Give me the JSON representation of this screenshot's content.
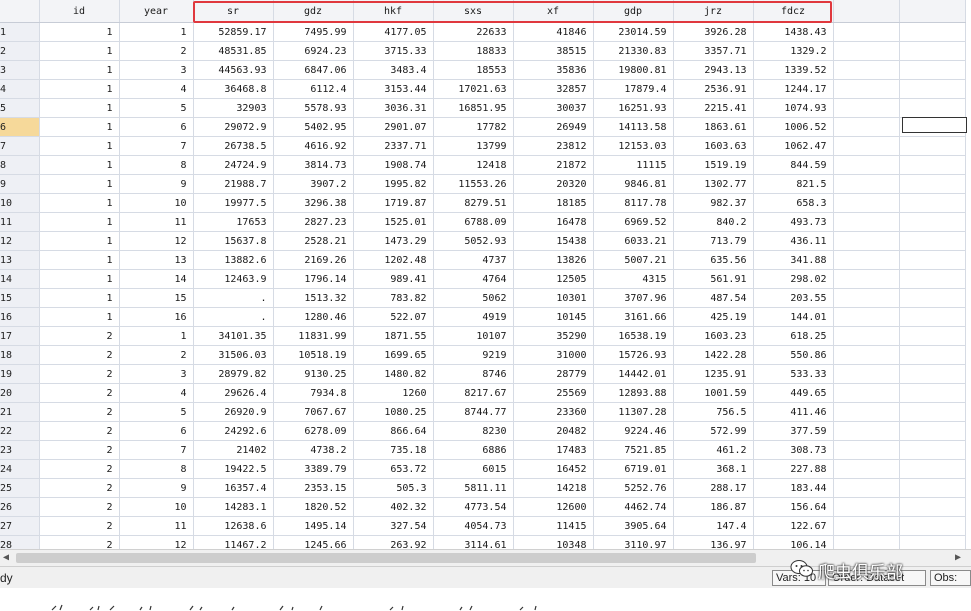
{
  "columns": [
    "id",
    "year",
    "sr",
    "gdz",
    "hkf",
    "sxs",
    "xf",
    "gdp",
    "jrz",
    "fdcz"
  ],
  "active_row": 6,
  "rows": [
    [
      "1",
      "1",
      "1",
      "52859.17",
      "7495.99",
      "4177.05",
      "22633",
      "41846",
      "23014.59",
      "3926.28",
      "1438.43"
    ],
    [
      "2",
      "1",
      "2",
      "48531.85",
      "6924.23",
      "3715.33",
      "18833",
      "38515",
      "21330.83",
      "3357.71",
      "1329.2"
    ],
    [
      "3",
      "1",
      "3",
      "44563.93",
      "6847.06",
      "3483.4",
      "18553",
      "35836",
      "19800.81",
      "2943.13",
      "1339.52"
    ],
    [
      "4",
      "1",
      "4",
      "36468.8",
      "6112.4",
      "3153.44",
      "17021.63",
      "32857",
      "17879.4",
      "2536.91",
      "1244.17"
    ],
    [
      "5",
      "1",
      "5",
      "32903",
      "5578.93",
      "3036.31",
      "16851.95",
      "30037",
      "16251.93",
      "2215.41",
      "1074.93"
    ],
    [
      "6",
      "1",
      "6",
      "29072.9",
      "5402.95",
      "2901.07",
      "17782",
      "26949",
      "14113.58",
      "1863.61",
      "1006.52"
    ],
    [
      "7",
      "1",
      "7",
      "26738.5",
      "4616.92",
      "2337.71",
      "13799",
      "23812",
      "12153.03",
      "1603.63",
      "1062.47"
    ],
    [
      "8",
      "1",
      "8",
      "24724.9",
      "3814.73",
      "1908.74",
      "12418",
      "21872",
      "11115",
      "1519.19",
      "844.59"
    ],
    [
      "9",
      "1",
      "9",
      "21988.7",
      "3907.2",
      "1995.82",
      "11553.26",
      "20320",
      "9846.81",
      "1302.77",
      "821.5"
    ],
    [
      "10",
      "1",
      "10",
      "19977.5",
      "3296.38",
      "1719.87",
      "8279.51",
      "18185",
      "8117.78",
      "982.37",
      "658.3"
    ],
    [
      "11",
      "1",
      "11",
      "17653",
      "2827.23",
      "1525.01",
      "6788.09",
      "16478",
      "6969.52",
      "840.2",
      "493.73"
    ],
    [
      "12",
      "1",
      "12",
      "15637.8",
      "2528.21",
      "1473.29",
      "5052.93",
      "15438",
      "6033.21",
      "713.79",
      "436.11"
    ],
    [
      "13",
      "1",
      "13",
      "13882.6",
      "2169.26",
      "1202.48",
      "4737",
      "13826",
      "5007.21",
      "635.56",
      "341.88"
    ],
    [
      "14",
      "1",
      "14",
      "12463.9",
      "1796.14",
      "989.41",
      "4764",
      "12505",
      "4315",
      "561.91",
      "298.02"
    ],
    [
      "15",
      "1",
      "15",
      ".",
      "1513.32",
      "783.82",
      "5062",
      "10301",
      "3707.96",
      "487.54",
      "203.55"
    ],
    [
      "16",
      "1",
      "16",
      ".",
      "1280.46",
      "522.07",
      "4919",
      "10145",
      "3161.66",
      "425.19",
      "144.01"
    ],
    [
      "17",
      "2",
      "1",
      "34101.35",
      "11831.99",
      "1871.55",
      "10107",
      "35290",
      "16538.19",
      "1603.23",
      "618.25"
    ],
    [
      "18",
      "2",
      "2",
      "31506.03",
      "10518.19",
      "1699.65",
      "9219",
      "31000",
      "15726.93",
      "1422.28",
      "550.86"
    ],
    [
      "19",
      "2",
      "3",
      "28979.82",
      "9130.25",
      "1480.82",
      "8746",
      "28779",
      "14442.01",
      "1235.91",
      "533.33"
    ],
    [
      "20",
      "2",
      "4",
      "29626.4",
      "7934.8",
      "1260",
      "8217.67",
      "25569",
      "12893.88",
      "1001.59",
      "449.65"
    ],
    [
      "21",
      "2",
      "5",
      "26920.9",
      "7067.67",
      "1080.25",
      "8744.77",
      "23360",
      "11307.28",
      "756.5",
      "411.46"
    ],
    [
      "22",
      "2",
      "6",
      "24292.6",
      "6278.09",
      "866.64",
      "8230",
      "20482",
      "9224.46",
      "572.99",
      "377.59"
    ],
    [
      "23",
      "2",
      "7",
      "21402",
      "4738.2",
      "735.18",
      "6886",
      "17483",
      "7521.85",
      "461.2",
      "308.73"
    ],
    [
      "24",
      "2",
      "8",
      "19422.5",
      "3389.79",
      "653.72",
      "6015",
      "16452",
      "6719.01",
      "368.1",
      "227.88"
    ],
    [
      "25",
      "2",
      "9",
      "16357.4",
      "2353.15",
      "505.3",
      "5811.11",
      "14218",
      "5252.76",
      "288.17",
      "183.44"
    ],
    [
      "26",
      "2",
      "10",
      "14283.1",
      "1820.52",
      "402.32",
      "4773.54",
      "12600",
      "4462.74",
      "186.87",
      "156.64"
    ],
    [
      "27",
      "2",
      "11",
      "12638.6",
      "1495.14",
      "327.54",
      "4054.73",
      "11415",
      "3905.64",
      "147.4",
      "122.67"
    ],
    [
      "28",
      "2",
      "12",
      "11467.2",
      "1245.66",
      "263.92",
      "3114.61",
      "10348",
      "3110.97",
      "136.97",
      "106.14"
    ]
  ],
  "status": {
    "ready_text": "dy",
    "vars_label": "Vars: 10",
    "order_label": "Order: Dataset",
    "obs_label": "Obs:"
  },
  "watermark": {
    "text": "爬虫俱乐部",
    "icon": "wechat-icon"
  },
  "colors": {
    "highlight": "#e0383e",
    "active_row": "#f6d99a",
    "header_bg": "#f3f4f7",
    "filler_header": "#fbf5dc"
  }
}
